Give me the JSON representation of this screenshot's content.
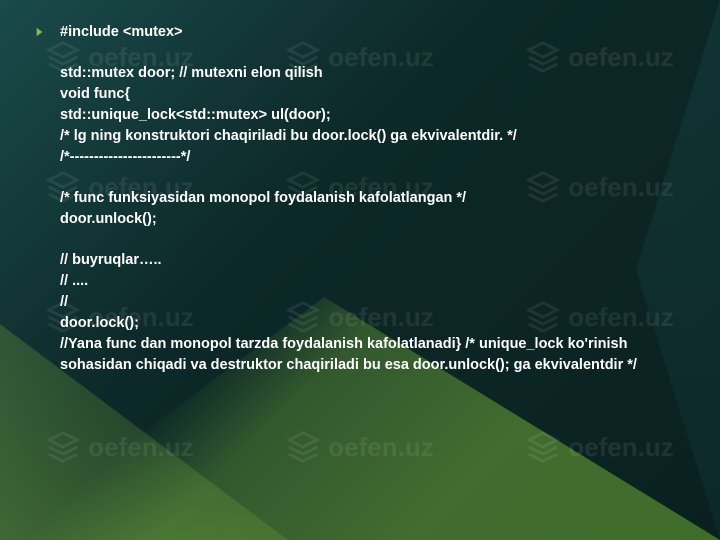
{
  "watermark": "oefen.uz",
  "lines": {
    "l1": "#include <mutex>",
    "l2": "std::mutex door; // mutexni elon qilish",
    "l3": "void func{",
    "l4a": "std::unique_lock<std::mutex>",
    "l4b": " ul(door);",
    "l5": "/* lg ning konstruktori chaqiriladi bu door.lock() ga ekvivalentdir. */",
    "l6": "/*-----------------------*/",
    "l7a": "/*",
    "l7b": " func funksiyasidan monopol foydalanish kafolatlangan *",
    "l7c": "/",
    "l8a": "door.",
    "l8b": "unlock()",
    "l8c": ";",
    "l9": "// buyruqlar…..",
    "l10": "// ....",
    "l11": "//",
    "l12a": "door.",
    "l12b": "lock();",
    "l13": "//Yana func dan monopol tarzda foydalanish kafolatlanadi} /* unique_lock ko'rinish sohasidan chiqadi va destruktor chaqiriladi bu esa door.unlock(); ga ekvivalentdir */"
  }
}
